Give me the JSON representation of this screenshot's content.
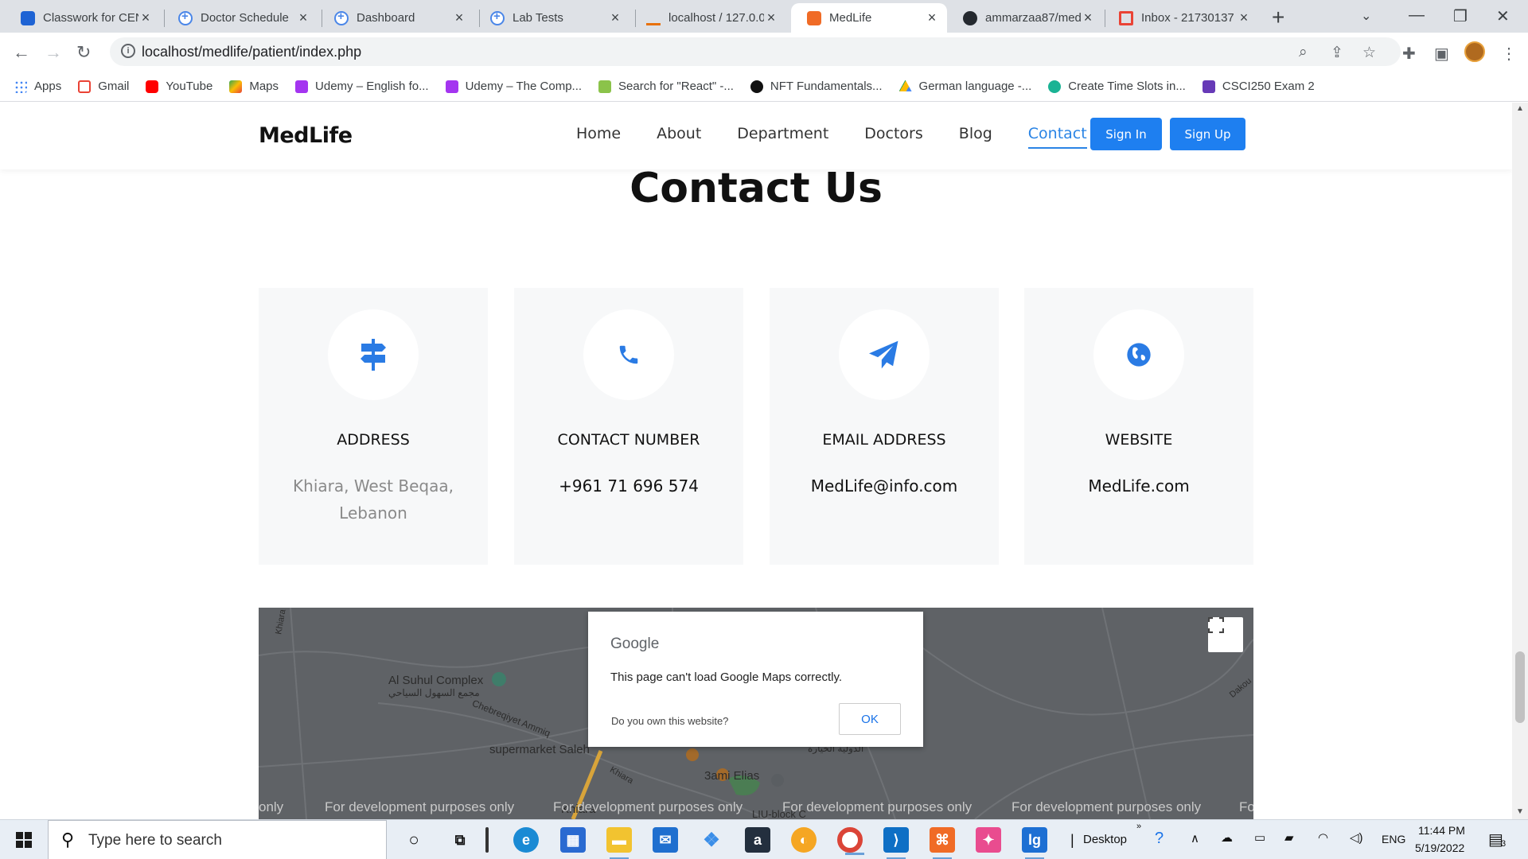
{
  "browser": {
    "tabs": [
      {
        "title": "Classwork for CEN",
        "icon": "classroom-icon"
      },
      {
        "title": "Doctor Schedule",
        "icon": "medical-cross-icon"
      },
      {
        "title": "Dashboard",
        "icon": "medical-cross-icon"
      },
      {
        "title": "Lab Tests",
        "icon": "medical-cross-icon"
      },
      {
        "title": "localhost / 127.0.0",
        "icon": "phpmyadmin-icon"
      },
      {
        "title": "MedLife",
        "icon": "medlife-icon",
        "active": true
      },
      {
        "title": "ammarzaa87/med",
        "icon": "github-icon"
      },
      {
        "title": "Inbox - 21730137",
        "icon": "gmail-icon"
      }
    ],
    "url": "localhost/medlife/patient/index.php",
    "bookmarks": [
      {
        "label": "Apps",
        "icon": "apps-grid-icon",
        "color": "#ea4335"
      },
      {
        "label": "Gmail",
        "icon": "gmail-icon",
        "color": "#ea4335"
      },
      {
        "label": "YouTube",
        "icon": "youtube-icon",
        "color": "#ff0000"
      },
      {
        "label": "Maps",
        "icon": "maps-icon",
        "color": "#34a853"
      },
      {
        "label": "Udemy – English fo...",
        "icon": "udemy-icon",
        "color": "#a435f0"
      },
      {
        "label": "Udemy – The Comp...",
        "icon": "udemy-icon",
        "color": "#a435f0"
      },
      {
        "label": "Search for \"React\" -...",
        "icon": "search-bookmark-icon",
        "color": "#8bc34a"
      },
      {
        "label": "NFT Fundamentals...",
        "icon": "nft-icon",
        "color": "#111111"
      },
      {
        "label": "German language -...",
        "icon": "drive-icon",
        "color": "#fbbc04"
      },
      {
        "label": "Create Time Slots in...",
        "icon": "dollar-icon",
        "color": "#1ab394"
      },
      {
        "label": "CSCI250 Exam 2",
        "icon": "forms-icon",
        "color": "#673ab7"
      }
    ]
  },
  "site": {
    "logo": "MedLife",
    "nav": [
      "Home",
      "About",
      "Department",
      "Doctors",
      "Blog",
      "Contact"
    ],
    "active_nav": "Contact",
    "sign_in": "Sign In",
    "sign_up": "Sign Up",
    "accent": "#1e7ff0"
  },
  "contact": {
    "title": "Contact Us",
    "cards": [
      {
        "title": "ADDRESS",
        "value": "Khiara, West Beqaa, Lebanon",
        "icon": "signpost-icon"
      },
      {
        "title": "CONTACT NUMBER",
        "value": "+961 71 696 574",
        "icon": "phone-icon"
      },
      {
        "title": "EMAIL ADDRESS",
        "value": "MedLife@info.com",
        "icon": "paper-plane-icon"
      },
      {
        "title": "WEBSITE",
        "value": "MedLife.com",
        "icon": "globe-icon"
      }
    ]
  },
  "map": {
    "dialog_brand": "Google",
    "dialog_message": "This page can't load Google Maps correctly.",
    "dialog_question": "Do you own this website?",
    "dialog_ok": "OK",
    "watermark": "For development purposes only",
    "watermark_partial_left": "only",
    "watermark_partial_right": "Fo",
    "labels": {
      "complex": "Al Suhul Complex",
      "complex_ar": "مجمع السهول السياحي",
      "road": "Chebreqiyet Ammiq",
      "supermarket": "supermarket Saleh",
      "restaurant": "3ami Elias",
      "khiara_top": "Khiara",
      "khiara_road": "Khiara",
      "ar_place": "الدولية الخيارة",
      "right_road": "Dakou",
      "town": "Khiara",
      "block": "LIU-block C"
    }
  },
  "taskbar": {
    "search_placeholder": "Type here to search",
    "desktop_label": "Desktop",
    "lang": "ENG",
    "time": "11:44 PM",
    "date": "5/19/2022",
    "notification_count": "3"
  }
}
